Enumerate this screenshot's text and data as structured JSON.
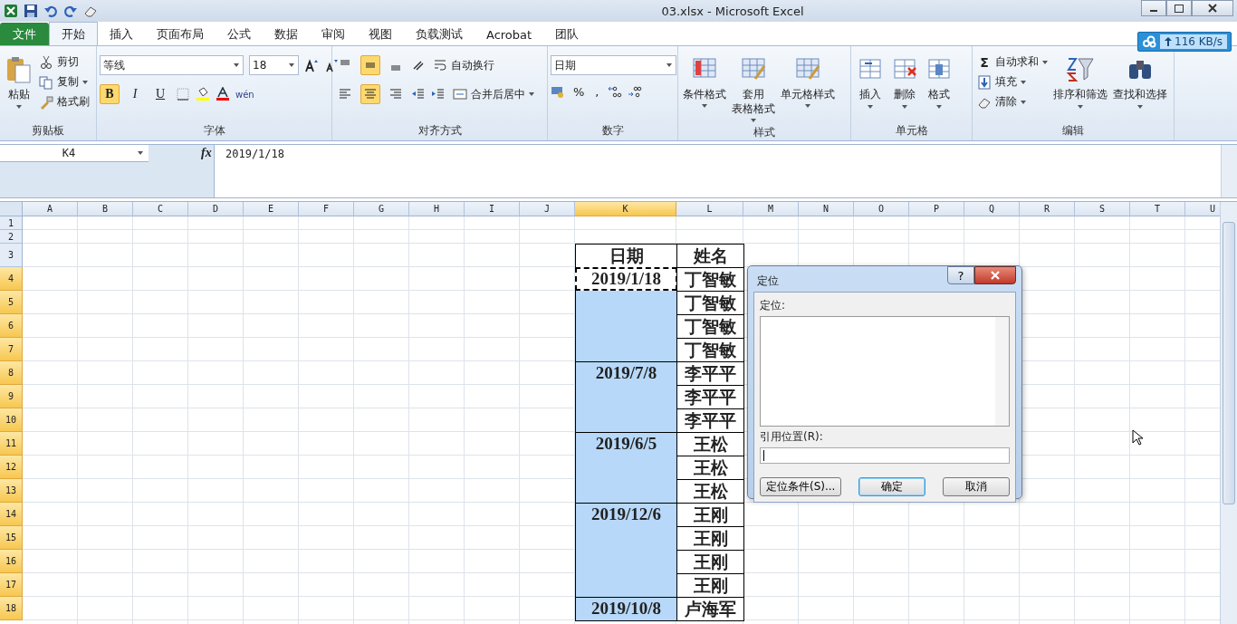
{
  "title_bar": {
    "title": "03.xlsx  -  Microsoft Excel"
  },
  "ribbon_tabs": [
    {
      "label": "文件",
      "kind": "file",
      "selected": false
    },
    {
      "label": "开始",
      "kind": "tab",
      "selected": true
    },
    {
      "label": "插入",
      "kind": "tab",
      "selected": false
    },
    {
      "label": "页面布局",
      "kind": "tab",
      "selected": false
    },
    {
      "label": "公式",
      "kind": "tab",
      "selected": false
    },
    {
      "label": "数据",
      "kind": "tab",
      "selected": false
    },
    {
      "label": "审阅",
      "kind": "tab",
      "selected": false
    },
    {
      "label": "视图",
      "kind": "tab",
      "selected": false
    },
    {
      "label": "负载测试",
      "kind": "tab",
      "selected": false
    },
    {
      "label": "Acrobat",
      "kind": "tab",
      "selected": false
    },
    {
      "label": "团队",
      "kind": "tab",
      "selected": false
    }
  ],
  "network_badge": {
    "speed": "116 KB/s"
  },
  "clipboard": {
    "paste": "粘贴",
    "cut": "剪切",
    "copy": "复制",
    "painter": "格式刷",
    "label": "剪贴板"
  },
  "font": {
    "name": "等线",
    "size": "18",
    "label": "字体",
    "phonetic": "wén",
    "style_buttons": [
      {
        "label": "B",
        "selected": true
      },
      {
        "label": "I",
        "selected": false
      },
      {
        "label": "U",
        "selected": false
      }
    ]
  },
  "alignment": {
    "wrap": "自动换行",
    "merge": "合并后居中",
    "label": "对齐方式",
    "vertical_buttons": [
      {
        "selected": false
      },
      {
        "selected": true
      },
      {
        "selected": false
      }
    ],
    "horizontal_buttons": [
      {
        "selected": false
      },
      {
        "selected": true
      },
      {
        "selected": false
      }
    ]
  },
  "number": {
    "format": "日期",
    "percent": "%",
    "comma": ",",
    "label": "数字"
  },
  "styles": {
    "buttons": [
      {
        "lines": [
          "条件格式"
        ]
      },
      {
        "lines": [
          "套用",
          "表格格式"
        ]
      },
      {
        "lines": [
          "单元格样式"
        ]
      }
    ],
    "label": "样式"
  },
  "cells": {
    "buttons": [
      "插入",
      "删除",
      "格式"
    ],
    "label": "单元格"
  },
  "editing": {
    "sigma": "Σ",
    "small": [
      "自动求和",
      "填充",
      "清除"
    ],
    "large": [
      "排序和筛选",
      "查找和选择"
    ],
    "label": "编辑"
  },
  "formula_bar": {
    "name_box": "K4",
    "function_label": "fx",
    "formula": "2019/1/18"
  },
  "sheet": {
    "columns": [
      {
        "label": "A",
        "selected": false
      },
      {
        "label": "B",
        "selected": false
      },
      {
        "label": "C",
        "selected": false
      },
      {
        "label": "D",
        "selected": false
      },
      {
        "label": "E",
        "selected": false
      },
      {
        "label": "F",
        "selected": false
      },
      {
        "label": "G",
        "selected": false
      },
      {
        "label": "H",
        "selected": false
      },
      {
        "label": "I",
        "selected": false
      },
      {
        "label": "J",
        "selected": false
      },
      {
        "label": "K",
        "selected": true
      },
      {
        "label": "L",
        "selected": false
      },
      {
        "label": "M",
        "selected": false
      },
      {
        "label": "N",
        "selected": false
      },
      {
        "label": "O",
        "selected": false
      },
      {
        "label": "P",
        "selected": false
      },
      {
        "label": "Q",
        "selected": false
      },
      {
        "label": "R",
        "selected": false
      },
      {
        "label": "S",
        "selected": false
      },
      {
        "label": "T",
        "selected": false
      },
      {
        "label": "U",
        "selected": false
      }
    ],
    "rows": [
      {
        "label": "1",
        "selected": false
      },
      {
        "label": "2",
        "selected": false
      },
      {
        "label": "3",
        "selected": false
      },
      {
        "label": "4",
        "selected": true
      },
      {
        "label": "5",
        "selected": true
      },
      {
        "label": "6",
        "selected": true
      },
      {
        "label": "7",
        "selected": true
      },
      {
        "label": "8",
        "selected": true
      },
      {
        "label": "9",
        "selected": true
      },
      {
        "label": "10",
        "selected": true
      },
      {
        "label": "11",
        "selected": true
      },
      {
        "label": "12",
        "selected": true
      },
      {
        "label": "13",
        "selected": true
      },
      {
        "label": "14",
        "selected": true
      },
      {
        "label": "15",
        "selected": true
      },
      {
        "label": "16",
        "selected": true
      },
      {
        "label": "17",
        "selected": true
      },
      {
        "label": "18",
        "selected": true
      }
    ],
    "table_header": [
      "日期",
      "姓名"
    ],
    "groups": [
      {
        "date": "2019/1/18",
        "active": true,
        "selected": true,
        "names": [
          "丁智敏",
          "丁智敏",
          "丁智敏",
          "丁智敏"
        ]
      },
      {
        "date": "2019/7/8",
        "active": false,
        "selected": true,
        "names": [
          "李平平",
          "李平平",
          "李平平"
        ]
      },
      {
        "date": "2019/6/5",
        "active": false,
        "selected": true,
        "names": [
          "王松",
          "王松",
          "王松"
        ]
      },
      {
        "date": "2019/12/6",
        "active": false,
        "selected": true,
        "names": [
          "王刚",
          "王刚",
          "王刚",
          "王刚"
        ]
      },
      {
        "date": "2019/10/8",
        "active": false,
        "selected": true,
        "names": [
          "卢海军"
        ]
      }
    ]
  },
  "dialog": {
    "title": "定位",
    "help": "?",
    "list_label": "定位:",
    "reference_label": "引用位置(R):",
    "buttons": [
      {
        "label": "定位条件(S)...",
        "kind": "normal"
      },
      {
        "label": "确定",
        "kind": "default"
      },
      {
        "label": "取消",
        "kind": "normal"
      }
    ]
  }
}
